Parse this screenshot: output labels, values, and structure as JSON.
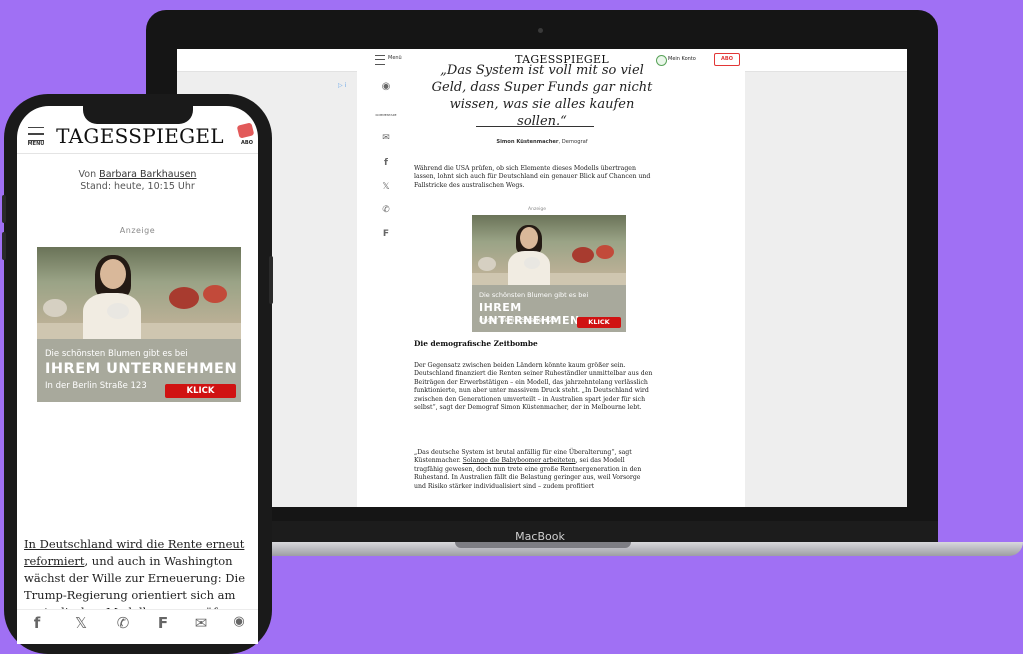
{
  "laptop": {
    "brand": "MacBook",
    "topbar": {
      "menu_label": "Menü",
      "logo": "TAGESSPIEGEL",
      "account_label": "Mein Konto",
      "abo_label": "ABO"
    },
    "ad_corner": "▷ i",
    "sidebar": {
      "comment_label": "KOMMENTARE"
    },
    "quote": "„Das System ist voll mit so viel Geld, dass Super Funds gar nicht wissen, was sie alles kaufen sollen.“",
    "quote_author": "Simon Küstenmacher",
    "quote_role": ", Demograf",
    "para1": "Während die USA prüfen, ob sich Elemente dieses Modells übertragen lassen, lohnt sich auch für Deutschland ein genauer Blick auf Chancen und Fallstricke des australischen Wegs.",
    "ad_label": "Anzeige",
    "heading": "Die demografische Zeitbombe",
    "para2": "Der Gegensatz zwischen beiden Ländern könnte kaum größer sein. Deutschland finanziert die Renten seiner Ruheständler unmittelbar aus den Beiträgen der Erwerbstätigen – ein Modell, das jahrzehntelang verlässlich funktionierte, nun aber unter massivem Druck steht. „In Deutschland wird zwischen den Generationen umverteilt – in Australien spart jeder für sich selbst“, sagt der Demograf Simon Küstenmacher, der in Melbourne lebt.",
    "para3_a": "„Das deutsche System ist brutal anfällig für eine Überalterung“, sagt Küstenmacher. ",
    "para3_link": "Solange die Babyboomer arbeiteten",
    "para3_b": ", sei das Modell tragfähig gewesen, doch nun trete eine große Rentnergeneration in den Ruhestand. In Australien fällt die Belastung geringer aus, weil Vorsorge und Risiko stärker individualisiert sind – zudem profitiert"
  },
  "ad": {
    "line1": "Die schönsten Blumen gibt es bei",
    "line2": "IHREM UNTERNEHMEN",
    "line3": "In der Berlin Straße 123",
    "cta": "KLICK"
  },
  "phone": {
    "menu_label": "MENÜ",
    "logo": "TAGESSPIEGEL",
    "abo_label": "ABO",
    "byline_prefix": "Von ",
    "author": "Barbara Barkhausen",
    "stand": "Stand: heute, 10:15 Uhr",
    "ad_label": "Anzeige",
    "lead_link": "In Deutschland wird die Rente erneut reformiert",
    "lead_rest": ", und auch in Washington wächst der Wille zur Erneuerung: Die Trump-Regierung orientiert sich am australischen Modell, um zu prüfen, wie sich das US-"
  },
  "icons": {
    "comment": "comment-icon",
    "mail": "mail-icon",
    "facebook": "facebook-icon",
    "x": "x-icon",
    "whatsapp": "whatsapp-icon",
    "flipboard": "flipboard-icon"
  },
  "colors": {
    "background": "#a070f4",
    "accent": "#d01212",
    "ad_banner": "#a8a99c"
  }
}
